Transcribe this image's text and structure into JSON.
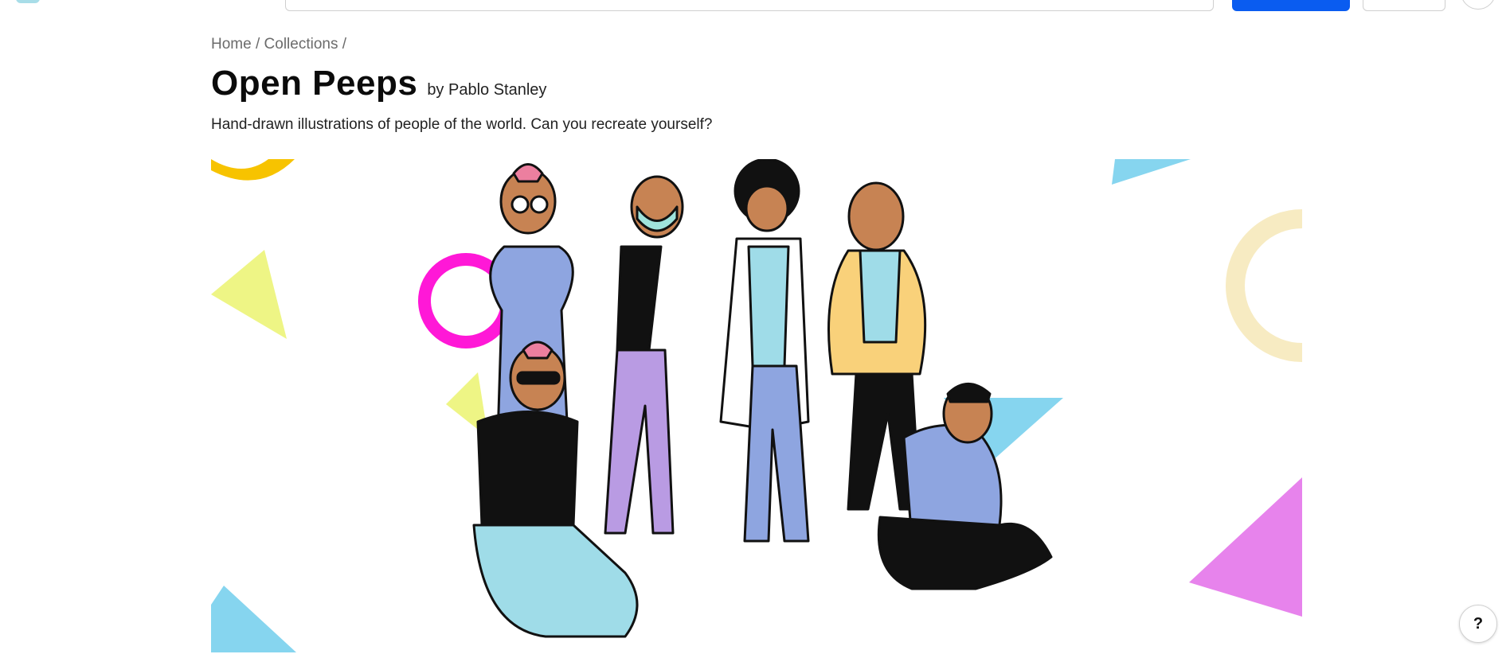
{
  "breadcrumb": {
    "home": "Home",
    "sep1": " / ",
    "collections": "Collections",
    "sep2": " /"
  },
  "collection": {
    "title": "Open Peeps",
    "byline": "by Pablo Stanley",
    "description": "Hand-drawn illustrations of people of the world. Can you recreate yourself?"
  },
  "hero": {
    "image_icon": "open-peeps-illustration"
  },
  "help_button": {
    "label": "?"
  },
  "colors": {
    "primary": "#0a5cf0",
    "shape_yellow": "#f7c300",
    "shape_lime": "#eef585",
    "shape_magenta": "#ff18d7",
    "shape_cyan": "#86d5ef",
    "shape_cream": "#f7ebc2",
    "shape_violet": "#e783ec"
  }
}
